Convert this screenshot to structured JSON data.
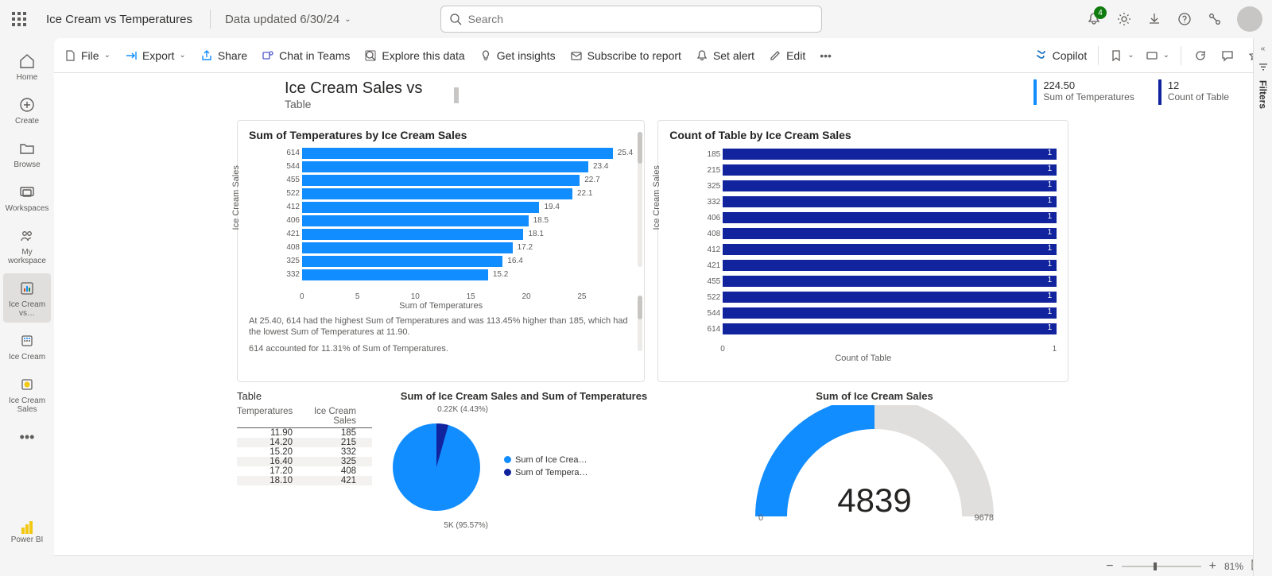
{
  "topbar": {
    "title": "Ice Cream vs Temperatures",
    "updated": "Data updated 6/30/24",
    "search_placeholder": "Search",
    "notif_count": "4"
  },
  "leftrail": {
    "items": [
      {
        "label": "Home"
      },
      {
        "label": "Create"
      },
      {
        "label": "Browse"
      },
      {
        "label": "Workspaces"
      },
      {
        "label": "My workspace"
      },
      {
        "label": "Ice Cream vs…"
      },
      {
        "label": "Ice Cream"
      },
      {
        "label": "Ice Cream Sales"
      }
    ],
    "footer": "Power BI"
  },
  "toolbar": {
    "file": "File",
    "export": "Export",
    "share": "Share",
    "chat": "Chat in Teams",
    "explore": "Explore this data",
    "insights": "Get insights",
    "subscribe": "Subscribe to report",
    "alert": "Set alert",
    "edit": "Edit",
    "copilot": "Copilot"
  },
  "report": {
    "title": "Ice Cream Sales vs",
    "subtitle": "Table",
    "kpi1_value": "224.50",
    "kpi1_label": "Sum of Temperatures",
    "kpi2_value": "12",
    "kpi2_label": "Count of Table"
  },
  "card1": {
    "title": "Sum of Temperatures by Ice Cream Sales",
    "ylabel": "Ice Cream Sales",
    "xlabel": "Sum of Temperatures",
    "xticks": [
      "0",
      "5",
      "10",
      "15",
      "20",
      "25"
    ],
    "insight1": "At 25.40, 614 had the highest Sum of Temperatures and was 113.45% higher than 185, which had the lowest Sum of Temperatures at 11.90.",
    "insight2": "614 accounted for 11.31% of Sum of Temperatures."
  },
  "card2": {
    "title": "Count of Table by Ice Cream Sales",
    "ylabel": "Ice Cream Sales",
    "xlabel": "Count of Table",
    "xticks": [
      "0",
      "1"
    ]
  },
  "card3": {
    "title": "Table",
    "col1": "Temperatures",
    "col2": "Ice Cream Sales"
  },
  "card4": {
    "title": "Sum of Ice Cream Sales and Sum of Temperatures",
    "label1": "0.22K (4.43%)",
    "label2": "5K (95.57%)",
    "legend1": "Sum of Ice Crea…",
    "legend2": "Sum of Tempera…"
  },
  "card5": {
    "title": "Sum of Ice Cream Sales",
    "value": "4839",
    "min": "0",
    "max": "9678"
  },
  "filters_label": "Filters",
  "zoom": "81%",
  "chart_data": {
    "bar1": {
      "type": "bar",
      "orientation": "horizontal",
      "ylabel": "Ice Cream Sales",
      "xlabel": "Sum of Temperatures",
      "xlim": [
        0,
        26
      ],
      "categories": [
        "614",
        "544",
        "455",
        "522",
        "412",
        "406",
        "421",
        "408",
        "325",
        "332"
      ],
      "values": [
        25.4,
        23.4,
        22.7,
        22.1,
        19.4,
        18.5,
        18.1,
        17.2,
        16.4,
        15.2
      ]
    },
    "bar2": {
      "type": "bar",
      "orientation": "horizontal",
      "ylabel": "Ice Cream Sales",
      "xlabel": "Count of Table",
      "xlim": [
        0,
        1
      ],
      "categories": [
        "185",
        "215",
        "325",
        "332",
        "406",
        "408",
        "412",
        "421",
        "455",
        "522",
        "544",
        "614"
      ],
      "values": [
        1,
        1,
        1,
        1,
        1,
        1,
        1,
        1,
        1,
        1,
        1,
        1
      ]
    },
    "table": [
      {
        "temp": "11.90",
        "sales": "185"
      },
      {
        "temp": "14.20",
        "sales": "215"
      },
      {
        "temp": "15.20",
        "sales": "332"
      },
      {
        "temp": "16.40",
        "sales": "325"
      },
      {
        "temp": "17.20",
        "sales": "408"
      },
      {
        "temp": "18.10",
        "sales": "421"
      }
    ],
    "pie": {
      "type": "pie",
      "series": [
        {
          "name": "Sum of Ice Cream Sales",
          "value": 4839,
          "pct": 95.57,
          "color": "#118dff"
        },
        {
          "name": "Sum of Temperatures",
          "value": 224.5,
          "pct": 4.43,
          "color": "#12239e"
        }
      ]
    },
    "gauge": {
      "type": "gauge",
      "value": 4839,
      "min": 0,
      "max": 9678
    }
  }
}
